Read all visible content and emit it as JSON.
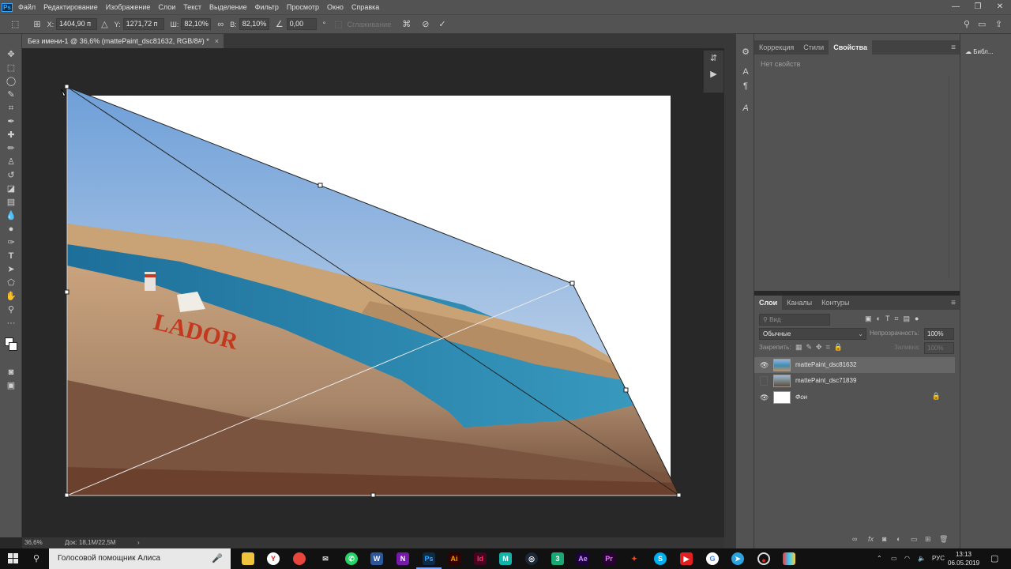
{
  "menubar": {
    "logo": "Ps",
    "items": [
      "Файл",
      "Редактирование",
      "Изображение",
      "Слои",
      "Текст",
      "Выделение",
      "Фильтр",
      "Просмотр",
      "Окно",
      "Справка"
    ]
  },
  "options": {
    "x_label": "X:",
    "x_value": "1404,90 п",
    "y_label": "Y:",
    "y_value": "1271,72 п",
    "w_label": "Ш:",
    "w_value": "82,10%",
    "h_label": "В:",
    "h_value": "82,10%",
    "angle_value": "0,00",
    "angle_unit": "°",
    "antialias": "Сглаживание"
  },
  "document": {
    "tab_title": "Без имени-1 @ 36,6% (mattePaint_dsc81632, RGB/8#) *",
    "close": "×",
    "art_text": "LADOR"
  },
  "status": {
    "zoom": "36,6%",
    "doc": "Док: 18,1M/22,5M",
    "arrow": "›"
  },
  "properties": {
    "tabs": [
      "Коррекция",
      "Стили",
      "Свойства"
    ],
    "active_tab": 2,
    "empty_text": "Нет свойств"
  },
  "layers": {
    "tabs": [
      "Слои",
      "Каналы",
      "Контуры"
    ],
    "kind_placeholder": "Вид",
    "blend_mode": "Обычные",
    "opacity_label": "Непрозрачность:",
    "opacity_value": "100%",
    "lock_label": "Закрепить:",
    "fill_label": "Заливка:",
    "fill_value": "100%",
    "items": [
      {
        "name": "mattePaint_dsc81632",
        "visible": true,
        "selected": true
      },
      {
        "name": "mattePaint_dsc71839",
        "visible": false,
        "selected": false
      },
      {
        "name": "Фон",
        "visible": true,
        "selected": false,
        "locked": true
      }
    ]
  },
  "library": {
    "label": "Библ..."
  },
  "taskbar": {
    "assistant_text": "Голосовой помощник Алиса",
    "lang": "РУС",
    "time": "13:13",
    "date": "06.05.2019"
  }
}
